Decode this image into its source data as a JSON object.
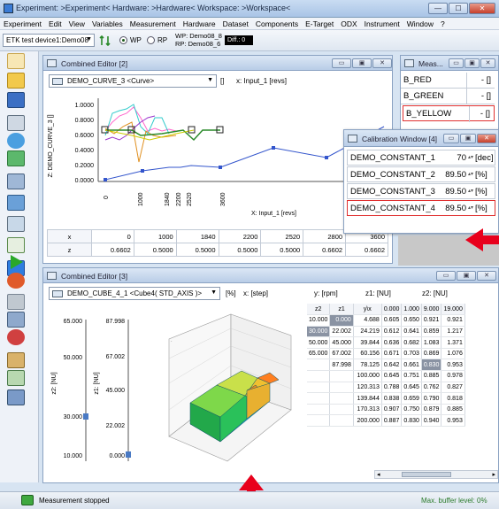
{
  "window": {
    "title": "Experiment: >Experiment< Hardware: >Hardware< Workspace: >Workspace<",
    "controls": [
      "—",
      "☐",
      "✕"
    ]
  },
  "menu": [
    "Experiment",
    "Edit",
    "View",
    "Variables",
    "Measurement",
    "Hardware",
    "Dataset",
    "Components",
    "E-Target",
    "ODX",
    "Instrument",
    "Window",
    "?"
  ],
  "toolbar": {
    "device": "ETK test device1:Demo08",
    "wp_label": "WP",
    "rp_label": "RP",
    "wp_info": "WP: Demo08_8",
    "rp_info": "RP: Demo08_6",
    "diff_label": "Diff.: 0"
  },
  "editor1": {
    "title": "Combined Editor [2]",
    "curve_select": "DEMO_CURVE_3 <Curve>",
    "unit_bracket": "[]",
    "x_input_label": "x: Input_1 [revs]",
    "y_axis_label": "Z: DEMO_CURVE_3 []",
    "x_axis_label": "X: Input_1 [revs]",
    "y_ticks": [
      "1.0000",
      "0.8000",
      "0.6000",
      "0.4000",
      "0.2000",
      "0.0000"
    ],
    "x_ticks": [
      "0",
      "1000",
      "1840",
      "2200",
      "2520",
      "3600"
    ],
    "table": {
      "x_label": "x",
      "z_label": "z",
      "x_values": [
        "0",
        "1000",
        "1840",
        "2200",
        "2520",
        "2800",
        "3600"
      ],
      "z_values": [
        "0.6602",
        "0.5000",
        "0.5000",
        "0.5000",
        "0.5000",
        "0.6602",
        "0.6602"
      ]
    }
  },
  "meas_window": {
    "title": "Meas...",
    "rows": [
      {
        "name": "B_RED",
        "value": "- []"
      },
      {
        "name": "B_GREEN",
        "value": "- []"
      },
      {
        "name": "B_YELLOW",
        "value": "- []"
      }
    ]
  },
  "calibration": {
    "title": "Calibration Window [4]",
    "rows": [
      {
        "name": "DEMO_CONSTANT_1",
        "value": "70",
        "unit": "[dec]"
      },
      {
        "name": "DEMO_CONSTANT_2",
        "value": "89.50",
        "unit": "[%]"
      },
      {
        "name": "DEMO_CONSTANT_3",
        "value": "89.50",
        "unit": "[%]"
      },
      {
        "name": "DEMO_CONSTANT_4",
        "value": "89.50",
        "unit": "[%]"
      }
    ]
  },
  "editor2": {
    "title": "Combined Editor [3]",
    "cube_select": "DEMO_CUBE_4_1 <Cube4( STD_AXIS )>",
    "unit_pct": "[%]",
    "x_step_label": "x: [step]",
    "y_rpm_label": "y: [rpm]",
    "z1_label": "z1: [NU]",
    "z2_label": "z2: [NU]",
    "axis_z2": "z2: [NU]",
    "axis_z1": "z1: [NU]",
    "z2_ticks": [
      "65.000",
      "50.000",
      "30.000",
      "10.000"
    ],
    "z1_ticks": [
      "87.998",
      "67.002",
      "45.000",
      "22.002",
      "0.000"
    ],
    "z_left_values": [
      "10.000",
      "30.000",
      "50.000",
      "65.000"
    ],
    "z1_col_values": [
      "0.000",
      "22.002",
      "45.000",
      "67.002",
      "87.998"
    ],
    "table_header": [
      "y\\x",
      "0.000",
      "1.000",
      "9.000",
      "19.000"
    ],
    "table_rows": [
      [
        "4.688",
        "0.605",
        "0.650",
        "0.921",
        "0.921"
      ],
      [
        "24.219",
        "0.612",
        "0.641",
        "0.859",
        "1.217"
      ],
      [
        "39.844",
        "0.636",
        "0.682",
        "1.083",
        "1.371"
      ],
      [
        "60.156",
        "0.671",
        "0.703",
        "0.869",
        "1.076"
      ],
      [
        "78.125",
        "0.642",
        "0.661",
        "0.830",
        "0.953"
      ],
      [
        "100.000",
        "0.645",
        "0.751",
        "0.885",
        "0.978"
      ],
      [
        "120.313",
        "0.788",
        "0.645",
        "0.762",
        "0.827"
      ],
      [
        "139.844",
        "0.838",
        "0.659",
        "0.790",
        "0.818"
      ],
      [
        "170.313",
        "0.907",
        "0.750",
        "0.879",
        "0.885"
      ],
      [
        "200.000",
        "0.887",
        "0.830",
        "0.940",
        "0.953"
      ]
    ]
  },
  "status": {
    "text": "Measurement stopped",
    "buffer": "Max. buffer level: 0%"
  },
  "colors": {
    "annotation_arrow": "#e8001c",
    "highlight_box": "#e03030",
    "curve_line": "#3355cc"
  }
}
